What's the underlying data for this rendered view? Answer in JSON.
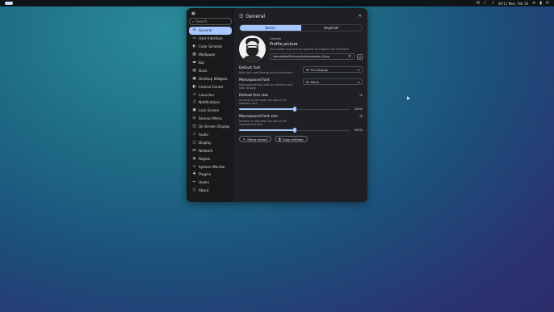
{
  "topbar": {
    "clock": "09:11 Mon, Feb 16",
    "tray_icons": [
      "chat-icon",
      "moon-icon",
      "speaker-icon",
      "wifi-icon",
      "battery-icon",
      "power-icon"
    ]
  },
  "sidebar": {
    "search_placeholder": "Search",
    "items": [
      {
        "label": "General",
        "icon": "sliders-icon",
        "active": true
      },
      {
        "label": "User Interface",
        "icon": "monitor-icon"
      },
      {
        "label": "Color Scheme",
        "icon": "palette-icon"
      },
      {
        "label": "Wallpaper",
        "icon": "image-icon"
      },
      {
        "label": "Bar",
        "icon": "bar-icon"
      },
      {
        "label": "Dock",
        "icon": "dock-icon"
      },
      {
        "label": "Desktop Widgets",
        "icon": "widgets-icon"
      },
      {
        "label": "Control Center",
        "icon": "control-icon"
      },
      {
        "label": "Launcher",
        "icon": "rocket-icon"
      },
      {
        "label": "Notifications",
        "icon": "bell-icon"
      },
      {
        "label": "Lock Screen",
        "icon": "lock-icon"
      },
      {
        "label": "Session Menu",
        "icon": "power-icon"
      },
      {
        "label": "On-Screen Display",
        "icon": "osd-icon"
      },
      {
        "label": "Audio",
        "icon": "speaker-icon"
      },
      {
        "label": "Display",
        "icon": "display-icon"
      },
      {
        "label": "Network",
        "icon": "network-icon"
      },
      {
        "label": "Region",
        "icon": "globe-icon"
      },
      {
        "label": "System Monitor",
        "icon": "pulse-icon"
      },
      {
        "label": "Plugins",
        "icon": "puzzle-icon"
      },
      {
        "label": "Hooks",
        "icon": "hook-icon"
      },
      {
        "label": "About",
        "icon": "info-icon"
      }
    ]
  },
  "main": {
    "title": "General",
    "tabs": [
      {
        "label": "Basics",
        "active": true
      },
      {
        "label": "Keybinds",
        "active": false
      }
    ],
    "greeting": "Greeats",
    "profile_title": "Profile picture",
    "profile_desc": "Your profile picture that appears throughout the interface.",
    "profile_path": "/home/jake/Pictures/Avatars/avatar_8.jpg",
    "default_font": {
      "label": "Default font",
      "desc": "Main font used throughout the interface.",
      "value": "SF Pro Display"
    },
    "mono_font": {
      "label": "Monospaced font",
      "desc": "Monospaced font used for numbers and stats display.",
      "value": "SF Mono"
    },
    "default_size": {
      "label": "Default font size",
      "desc": "Increase or decrease the size of the standard font.",
      "percent": "100%",
      "fraction": 0.5
    },
    "mono_size": {
      "label": "Monospaced font size",
      "desc": "Increase or decrease the size of the monospaced font.",
      "percent": "100%",
      "fraction": 0.5
    },
    "buttons": {
      "setup": "Setup wizard",
      "copy": "Copy settings"
    }
  },
  "colors": {
    "accent": "#a9c7ff",
    "window_bg": "#1e2023",
    "sidebar_bg": "#17191b"
  }
}
